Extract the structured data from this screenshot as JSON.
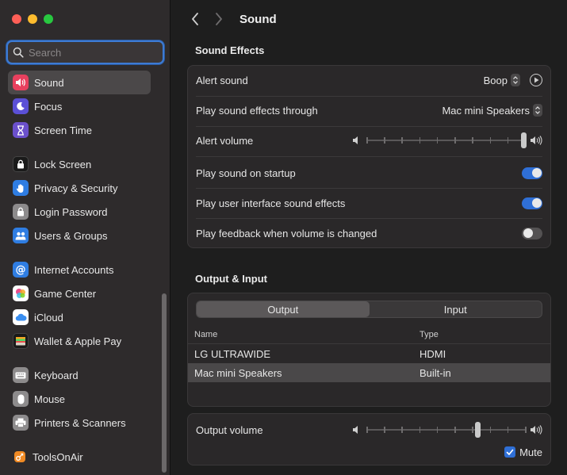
{
  "sidebar": {
    "search_placeholder": "Search",
    "items": [
      {
        "label": "Sound",
        "icon": "speaker-icon",
        "color": "#e83a5a"
      },
      {
        "label": "Focus",
        "icon": "moon-icon",
        "color": "#5a4fd0"
      },
      {
        "label": "Screen Time",
        "icon": "hourglass-icon",
        "color": "#6a4fc8"
      },
      {
        "label": "Lock Screen",
        "icon": "lock-icon",
        "color": "#1c1c1c"
      },
      {
        "label": "Privacy & Security",
        "icon": "hand-icon",
        "color": "#2e7be0"
      },
      {
        "label": "Login Password",
        "icon": "lock-icon",
        "color": "#8a8889"
      },
      {
        "label": "Users & Groups",
        "icon": "users-icon",
        "color": "#2e7be0"
      },
      {
        "label": "Internet Accounts",
        "icon": "at-icon",
        "color": "#2e7be0"
      },
      {
        "label": "Game Center",
        "icon": "game-center-icon",
        "color": "#ffffff"
      },
      {
        "label": "iCloud",
        "icon": "cloud-icon",
        "color": "#ffffff"
      },
      {
        "label": "Wallet & Apple Pay",
        "icon": "wallet-icon",
        "color": "#1c1c1c"
      },
      {
        "label": "Keyboard",
        "icon": "keyboard-icon",
        "color": "#8a8889"
      },
      {
        "label": "Mouse",
        "icon": "mouse-icon",
        "color": "#8a8889"
      },
      {
        "label": "Printers & Scanners",
        "icon": "printer-icon",
        "color": "#8a8889"
      },
      {
        "label": "ToolsOnAir",
        "icon": "toolsonair-icon",
        "color": "#f08a24"
      }
    ]
  },
  "header": {
    "title": "Sound"
  },
  "sound_effects": {
    "title": "Sound Effects",
    "alert_sound_label": "Alert sound",
    "alert_sound_value": "Boop",
    "play_through_label": "Play sound effects through",
    "play_through_value": "Mac mini Speakers",
    "alert_volume_label": "Alert volume",
    "alert_volume_level": 1.0,
    "startup_label": "Play sound on startup",
    "startup_on": true,
    "ui_effects_label": "Play user interface sound effects",
    "ui_effects_on": true,
    "feedback_label": "Play feedback when volume is changed",
    "feedback_on": false
  },
  "output_input": {
    "title": "Output & Input",
    "tab_output": "Output",
    "tab_input": "Input",
    "col_name": "Name",
    "col_type": "Type",
    "devices": [
      {
        "name": "LG ULTRAWIDE",
        "type": "HDMI"
      },
      {
        "name": "Mac mini Speakers",
        "type": "Built-in"
      }
    ],
    "output_volume_label": "Output volume",
    "output_volume_level": 0.7,
    "mute_label": "Mute",
    "mute_checked": true
  },
  "colors": {
    "accent": "#2f6fd6",
    "active_item": "#4b4849"
  }
}
